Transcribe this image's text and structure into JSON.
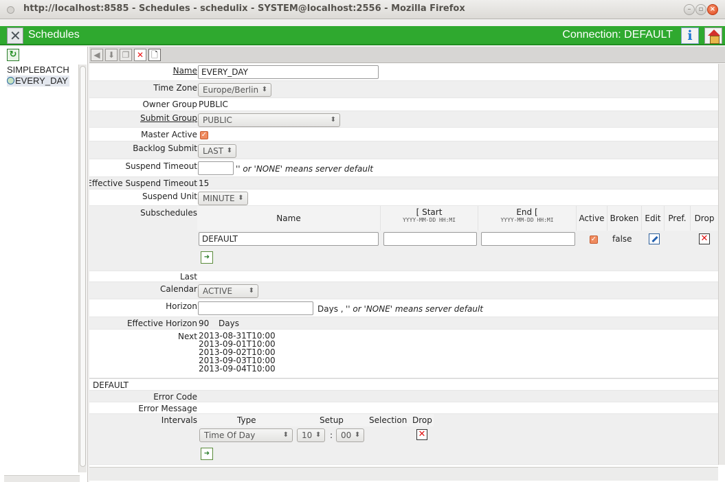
{
  "window": {
    "title": "http://localhost:8585 - Schedules - schedulix - SYSTEM@localhost:2556 - Mozilla Firefox"
  },
  "app": {
    "title": "Schedules",
    "connection": "Connection: DEFAULT"
  },
  "tree": {
    "items": [
      "SIMPLEBATCH",
      "EVERY_DAY"
    ]
  },
  "form": {
    "name_label": "Name",
    "name_value": "EVERY_DAY",
    "timezone_label": "Time Zone",
    "timezone_value": "Europe/Berlin",
    "owner_label": "Owner Group",
    "owner_value": "PUBLIC",
    "submit_label": "Submit Group",
    "submit_value": "PUBLIC",
    "master_label": "Master Active",
    "backlog_label": "Backlog Submit",
    "backlog_value": "LAST",
    "suspend_timeout_label": "Suspend Timeout",
    "suspend_timeout_note": "'' or 'NONE' means server default",
    "eff_suspend_label": "Effective Suspend Timeout",
    "eff_suspend_value": "15",
    "suspend_unit_label": "Suspend Unit",
    "suspend_unit_value": "MINUTE",
    "subschedules_label": "Subschedules",
    "last_label": "Last",
    "calendar_label": "Calendar",
    "calendar_value": "ACTIVE",
    "horizon_label": "Horizon",
    "horizon_note_days": "Days ,",
    "horizon_note": "'' or 'NONE' means server default",
    "eff_horizon_label": "Effective Horizon",
    "eff_horizon_value": "90",
    "eff_horizon_unit": "Days",
    "next_label": "Next",
    "next_values": [
      "2013-08-31T10:00",
      "2013-09-01T10:00",
      "2013-09-02T10:00",
      "2013-09-03T10:00",
      "2013-09-04T10:00"
    ]
  },
  "subschedules": {
    "headers": {
      "name": "Name",
      "start": "[ Start",
      "start_fmt": "YYYY-MM-DD HH:MI",
      "end": "End [",
      "end_fmt": "YYYY-MM-DD HH:MI",
      "active": "Active",
      "broken": "Broken",
      "edit": "Edit",
      "pref": "Pref.",
      "drop": "Drop"
    },
    "rows": [
      {
        "name": "DEFAULT",
        "start": "",
        "end": "",
        "broken": "false"
      }
    ]
  },
  "default_section": {
    "title": "DEFAULT",
    "error_code_label": "Error Code",
    "error_message_label": "Error Message",
    "intervals_label": "Intervals",
    "headers": {
      "type": "Type",
      "setup": "Setup",
      "selection": "Selection",
      "drop": "Drop"
    },
    "row": {
      "type": "Time Of Day",
      "hour": "10",
      "sep": ":",
      "minute": "00"
    }
  },
  "colors": {
    "app_header": "#2fa92f",
    "check": "#ef8b5f",
    "drop": "#e01010"
  },
  "icons": [
    "refresh-icon",
    "back-icon",
    "save-icon",
    "copy-icon",
    "delete-icon",
    "new-document-icon",
    "info-icon",
    "home-icon",
    "edit-icon",
    "add-row-icon"
  ]
}
